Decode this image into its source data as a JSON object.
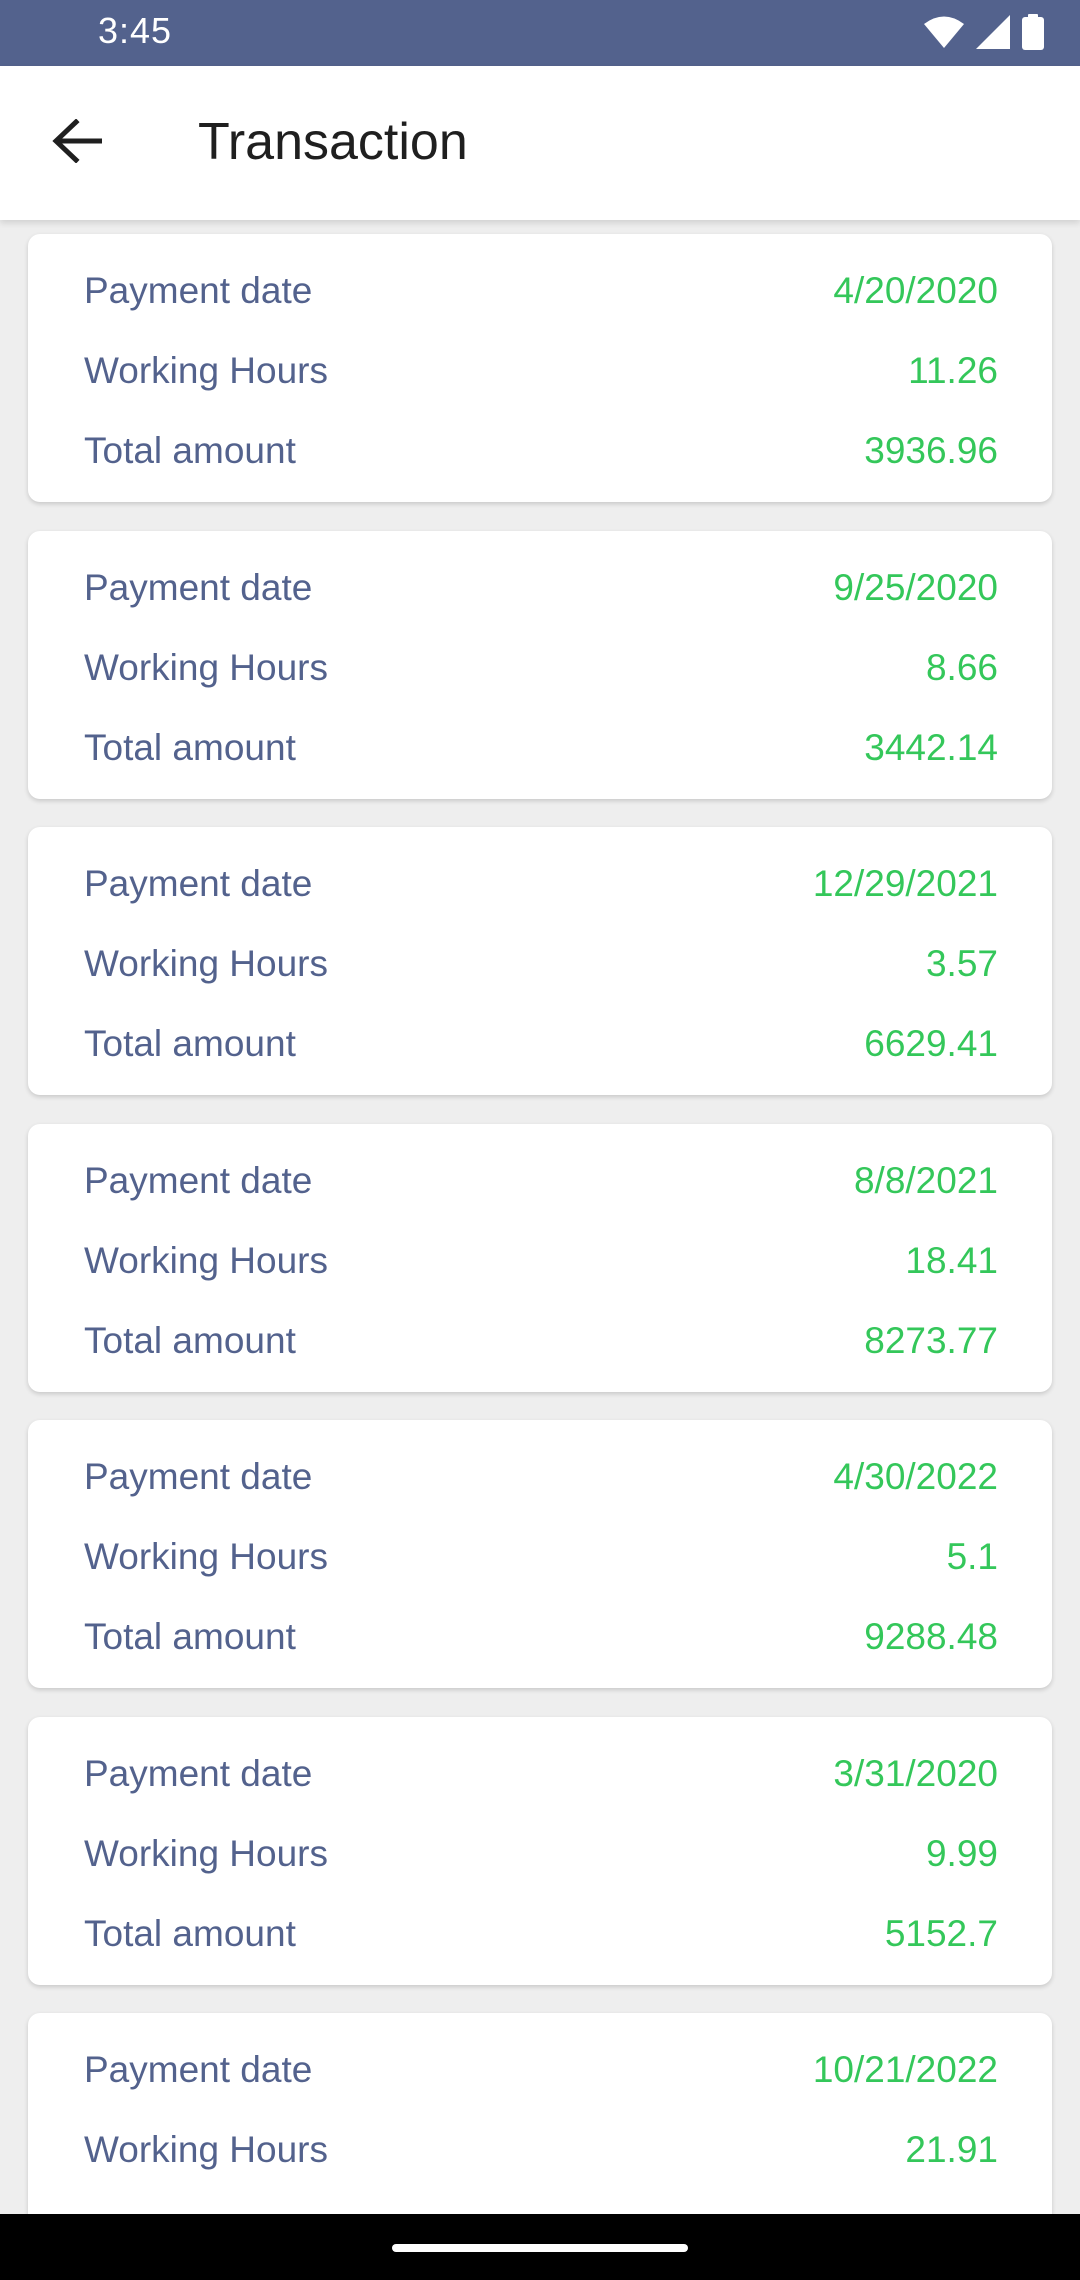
{
  "status_bar": {
    "time": "3:45"
  },
  "app_bar": {
    "title": "Transaction"
  },
  "labels": {
    "payment_date": "Payment date",
    "working_hours": "Working Hours",
    "total_amount": "Total amount"
  },
  "transactions": [
    {
      "payment_date": "4/20/2020",
      "working_hours": "11.26",
      "total_amount": "3936.96"
    },
    {
      "payment_date": "9/25/2020",
      "working_hours": "8.66",
      "total_amount": "3442.14"
    },
    {
      "payment_date": "12/29/2021",
      "working_hours": "3.57",
      "total_amount": "6629.41"
    },
    {
      "payment_date": "8/8/2021",
      "working_hours": "18.41",
      "total_amount": "8273.77"
    },
    {
      "payment_date": "4/30/2022",
      "working_hours": "5.1",
      "total_amount": "9288.48"
    },
    {
      "payment_date": "3/31/2020",
      "working_hours": "9.99",
      "total_amount": "5152.7"
    },
    {
      "payment_date": "10/21/2022",
      "working_hours": "21.91",
      "total_amount": ""
    }
  ],
  "colors": {
    "primary": "#53628d",
    "value_green": "#34c75a",
    "background": "#eeeeee"
  }
}
